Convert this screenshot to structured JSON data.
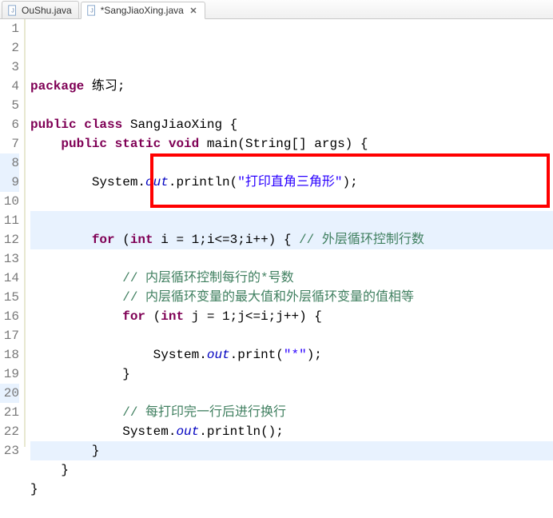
{
  "tabs": [
    {
      "label": "OuShu.java",
      "active": false
    },
    {
      "label": "*SangJiaoXing.java",
      "active": true
    }
  ],
  "code": {
    "lines": [
      {
        "n": 1,
        "tokens": [
          [
            "kw",
            "package"
          ],
          [
            "pl",
            " 练习;"
          ]
        ]
      },
      {
        "n": 2,
        "tokens": []
      },
      {
        "n": 3,
        "tokens": [
          [
            "kw",
            "public"
          ],
          [
            "pl",
            " "
          ],
          [
            "kw",
            "class"
          ],
          [
            "pl",
            " SangJiaoXing {"
          ]
        ]
      },
      {
        "n": 4,
        "tokens": [
          [
            "pl",
            "    "
          ],
          [
            "kw",
            "public"
          ],
          [
            "pl",
            " "
          ],
          [
            "kw",
            "static"
          ],
          [
            "pl",
            " "
          ],
          [
            "kw",
            "void"
          ],
          [
            "pl",
            " main(String[] args) {"
          ]
        ]
      },
      {
        "n": 5,
        "tokens": []
      },
      {
        "n": 6,
        "tokens": [
          [
            "pl",
            "        System."
          ],
          [
            "fld",
            "out"
          ],
          [
            "pl",
            ".println("
          ],
          [
            "str",
            "\"打印直角三角形\""
          ],
          [
            "pl",
            ");"
          ]
        ]
      },
      {
        "n": 7,
        "tokens": []
      },
      {
        "n": 8,
        "tokens": [],
        "hl": true
      },
      {
        "n": 9,
        "tokens": [
          [
            "pl",
            "        "
          ],
          [
            "kw",
            "for"
          ],
          [
            "pl",
            " ("
          ],
          [
            "kw",
            "int"
          ],
          [
            "pl",
            " i = 1;i<=3;i++) { "
          ],
          [
            "com",
            "// 外层循环控制行数"
          ]
        ],
        "hl": true
      },
      {
        "n": 10,
        "tokens": []
      },
      {
        "n": 11,
        "tokens": [
          [
            "pl",
            "            "
          ],
          [
            "com",
            "// 内层循环控制每行的*号数"
          ]
        ]
      },
      {
        "n": 12,
        "tokens": [
          [
            "pl",
            "            "
          ],
          [
            "com",
            "// 内层循环变量的最大值和外层循环变量的值相等"
          ]
        ]
      },
      {
        "n": 13,
        "tokens": [
          [
            "pl",
            "            "
          ],
          [
            "kw",
            "for"
          ],
          [
            "pl",
            " ("
          ],
          [
            "kw",
            "int"
          ],
          [
            "pl",
            " j = 1;j<=i;j++) {"
          ]
        ]
      },
      {
        "n": 14,
        "tokens": []
      },
      {
        "n": 15,
        "tokens": [
          [
            "pl",
            "                System."
          ],
          [
            "fld",
            "out"
          ],
          [
            "pl",
            ".print("
          ],
          [
            "str",
            "\"*\""
          ],
          [
            "pl",
            ");"
          ]
        ]
      },
      {
        "n": 16,
        "tokens": [
          [
            "pl",
            "            }"
          ]
        ]
      },
      {
        "n": 17,
        "tokens": []
      },
      {
        "n": 18,
        "tokens": [
          [
            "pl",
            "            "
          ],
          [
            "com",
            "// 每打印完一行后进行换行"
          ]
        ]
      },
      {
        "n": 19,
        "tokens": [
          [
            "pl",
            "            System."
          ],
          [
            "fld",
            "out"
          ],
          [
            "pl",
            ".println();"
          ]
        ]
      },
      {
        "n": 20,
        "tokens": [
          [
            "pl",
            "        }"
          ]
        ],
        "hl": true
      },
      {
        "n": 21,
        "tokens": [
          [
            "pl",
            "    }"
          ]
        ]
      },
      {
        "n": 22,
        "tokens": [
          [
            "pl",
            "}"
          ]
        ]
      },
      {
        "n": 23,
        "tokens": []
      }
    ]
  }
}
